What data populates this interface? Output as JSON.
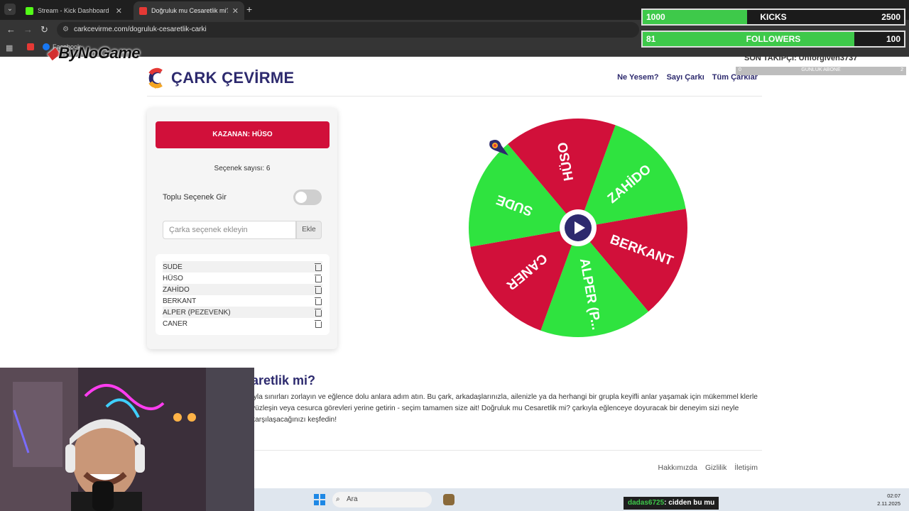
{
  "browser": {
    "tabs": [
      {
        "title": "Stream - Kick Dashboard",
        "favicon_color": "#53fc18"
      },
      {
        "title": "Doğruluk mu Cesaretlik mi? - Ç",
        "favicon_color": "#e53935"
      }
    ],
    "url": "carkcevirme.com/dogruluk-cesaretlik-carki",
    "bookmark": "Facebook"
  },
  "overlay": {
    "streamer_logo": "ByNoGame",
    "kicks": {
      "current": "1000",
      "label": "KICKS",
      "goal": "2500",
      "progress": 0.4
    },
    "followers": {
      "current": "81",
      "label": "FOLLOWERS",
      "goal": "100",
      "progress": 0.81
    },
    "last_follower": "SON TAKİPÇİ: Unforgiven3737",
    "daily_sub": {
      "left": "0",
      "label": "GÜNLÜK ABONE",
      "right": "2"
    }
  },
  "site": {
    "logo_text": "ÇARK ÇEVİRME",
    "nav": [
      "Ne Yesem?",
      "Sayı Çarkı",
      "Tüm Çarklar"
    ]
  },
  "panel": {
    "winner_label": "KAZANAN: HÜSO",
    "option_count": "Seçenek sayısı: 6",
    "bulk_toggle_label": "Toplu Seçenek Gir",
    "bulk_toggle_on": false,
    "input_placeholder": "Çarka seçenek ekleyin",
    "add_button": "Ekle",
    "options": [
      "SUDE",
      "HÜSO",
      "ZAHİDO",
      "BERKANT",
      "ALPER (PEZEVENK)",
      "CANER"
    ]
  },
  "wheel": {
    "segments": [
      {
        "label": "ZAHİDO",
        "color": "#2fe33f"
      },
      {
        "label": "BERKANT",
        "color": "#d1103a"
      },
      {
        "label": "ALPER (P...",
        "color": "#2fe33f"
      },
      {
        "label": "CANER",
        "color": "#d1103a"
      },
      {
        "label": "SUDE",
        "color": "#2fe33f"
      },
      {
        "label": "HÜSO",
        "color": "#d1103a"
      }
    ],
    "center_icon": "play-icon"
  },
  "article": {
    "title": "aretlik mi?",
    "body": "ıyla sınırları zorlayın ve eğlence dolu anlara adım atın. Bu çark, arkadaşlarınızla, ailenizle ya da herhangi bir grupla keyifli anlar yaşamak için mükemmel klerle yüzleşin veya cesurca görevleri yerine getirin - seçim tamamen size ait! Doğruluk mu Cesaretlik mi? çarkıyla eğlenceye doyuracak bir deneyim sizi neyle karşılaşacağınızı keşfedin!"
  },
  "footer": {
    "links": [
      "Hakkımızda",
      "Gizlilik",
      "İletişim"
    ]
  },
  "taskbar": {
    "search_label": "Ara",
    "chat_user": "dadas6725",
    "chat_message": ": cidden bu mu",
    "time": "02:07",
    "date": "2.11.2025"
  }
}
